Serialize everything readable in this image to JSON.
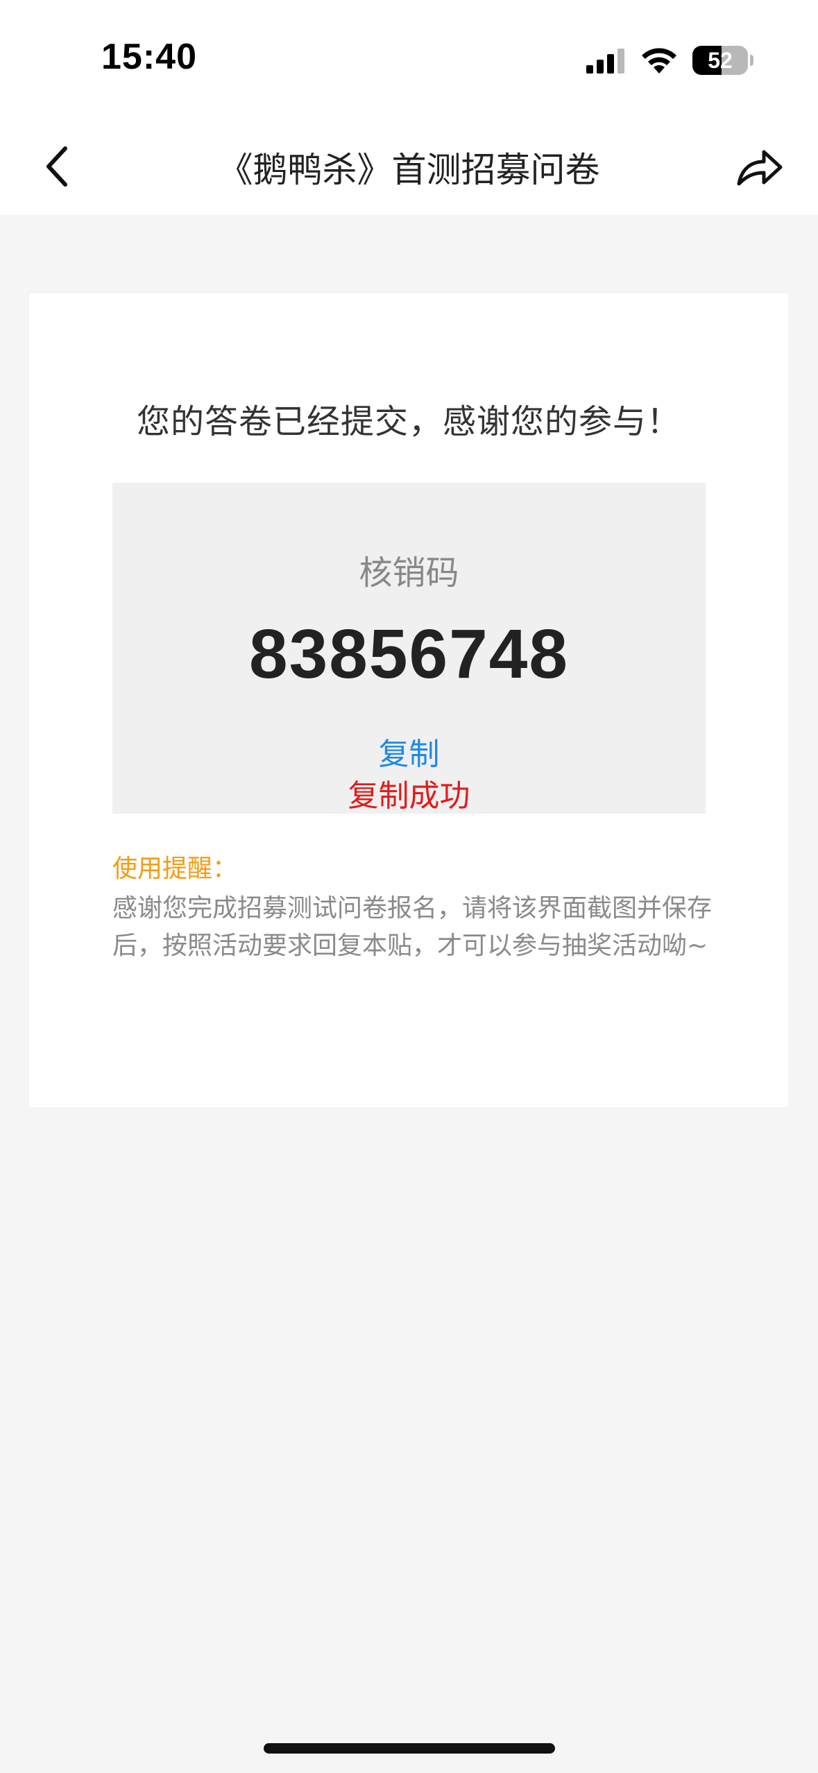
{
  "status_bar": {
    "time": "15:40",
    "battery_level": "52"
  },
  "nav": {
    "title": "《鹅鸭杀》首测招募问卷"
  },
  "card": {
    "thanks_message": "您的答卷已经提交，感谢您的参与！",
    "code_label": "核销码",
    "code_value": "83856748",
    "copy_label": "复制",
    "copy_success_label": "复制成功",
    "reminder_title": "使用提醒：",
    "reminder_body": "感谢您完成招募测试问卷报名，请将该界面截图并保存后，按照活动要求回复本贴，才可以参与抽奖活动呦~"
  },
  "colors": {
    "link_blue": "#1e88e5",
    "success_red": "#e31b1b",
    "reminder_orange": "#f39c12",
    "page_bg": "#f5f5f5"
  }
}
